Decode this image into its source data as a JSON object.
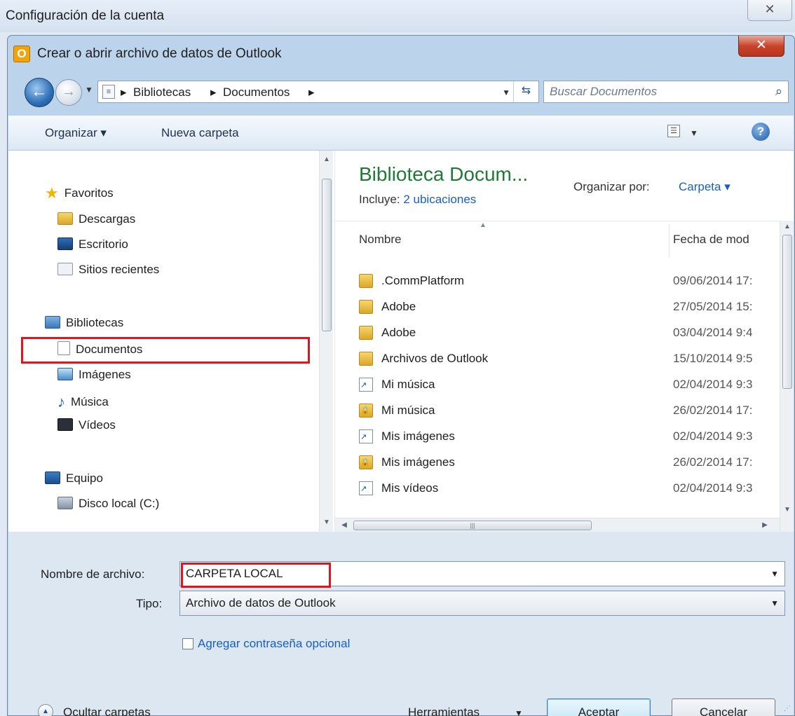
{
  "parent": {
    "title": "Configuración de la cuenta",
    "close_glyph": "✕"
  },
  "dialog": {
    "title": "Crear o abrir archivo de datos de Outlook",
    "app_icon": "O",
    "close_glyph": "✕"
  },
  "address": {
    "crumbs": [
      "Bibliotecas",
      "Documentos"
    ],
    "search_placeholder": "Buscar Documentos"
  },
  "toolbar": {
    "organize_label": "Organizar ▾",
    "new_folder_label": "Nueva carpeta",
    "help_glyph": "?"
  },
  "sidebar": {
    "favorites": "Favoritos",
    "downloads": "Descargas",
    "desktop": "Escritorio",
    "recent": "Sitios recientes",
    "libraries": "Bibliotecas",
    "documents": "Documentos",
    "pictures": "Imágenes",
    "music": "Música",
    "videos": "Vídeos",
    "computer": "Equipo",
    "local_disk": "Disco local (C:)"
  },
  "library": {
    "title": "Biblioteca Docum...",
    "includes_label": "Incluye:",
    "includes_link": "2 ubicaciones",
    "arrange_label": "Organizar por:",
    "arrange_value": "Carpeta ▾"
  },
  "columns": {
    "name": "Nombre",
    "date": "Fecha de mod"
  },
  "files": [
    {
      "name": ".CommPlatform",
      "date": "09/06/2014 17:",
      "icon": "folder"
    },
    {
      "name": "Adobe",
      "date": "27/05/2014 15:",
      "icon": "folder"
    },
    {
      "name": "Adobe",
      "date": "03/04/2014 9:4",
      "icon": "folder"
    },
    {
      "name": "Archivos de Outlook",
      "date": "15/10/2014 9:5",
      "icon": "folder"
    },
    {
      "name": "Mi música",
      "date": "02/04/2014 9:3",
      "icon": "shortcut"
    },
    {
      "name": "Mi música",
      "date": "26/02/2014 17:",
      "icon": "lock"
    },
    {
      "name": "Mis imágenes",
      "date": "02/04/2014 9:3",
      "icon": "shortcut"
    },
    {
      "name": "Mis imágenes",
      "date": "26/02/2014 17:",
      "icon": "lock"
    },
    {
      "name": "Mis vídeos",
      "date": "02/04/2014 9:3",
      "icon": "shortcut"
    }
  ],
  "form": {
    "filename_label": "Nombre de archivo:",
    "filename_value": "CARPETA LOCAL",
    "type_label": "Tipo:",
    "type_value": "Archivo de datos de Outlook",
    "password_label": "Agregar contraseña opcional",
    "hide_folders": "Ocultar carpetas",
    "tools": "Herramientas",
    "accept": "Aceptar",
    "cancel": "Cancelar"
  },
  "colors": {
    "highlight": "#e0161f",
    "library_title": "#1f7a37",
    "link": "#1760b8"
  }
}
